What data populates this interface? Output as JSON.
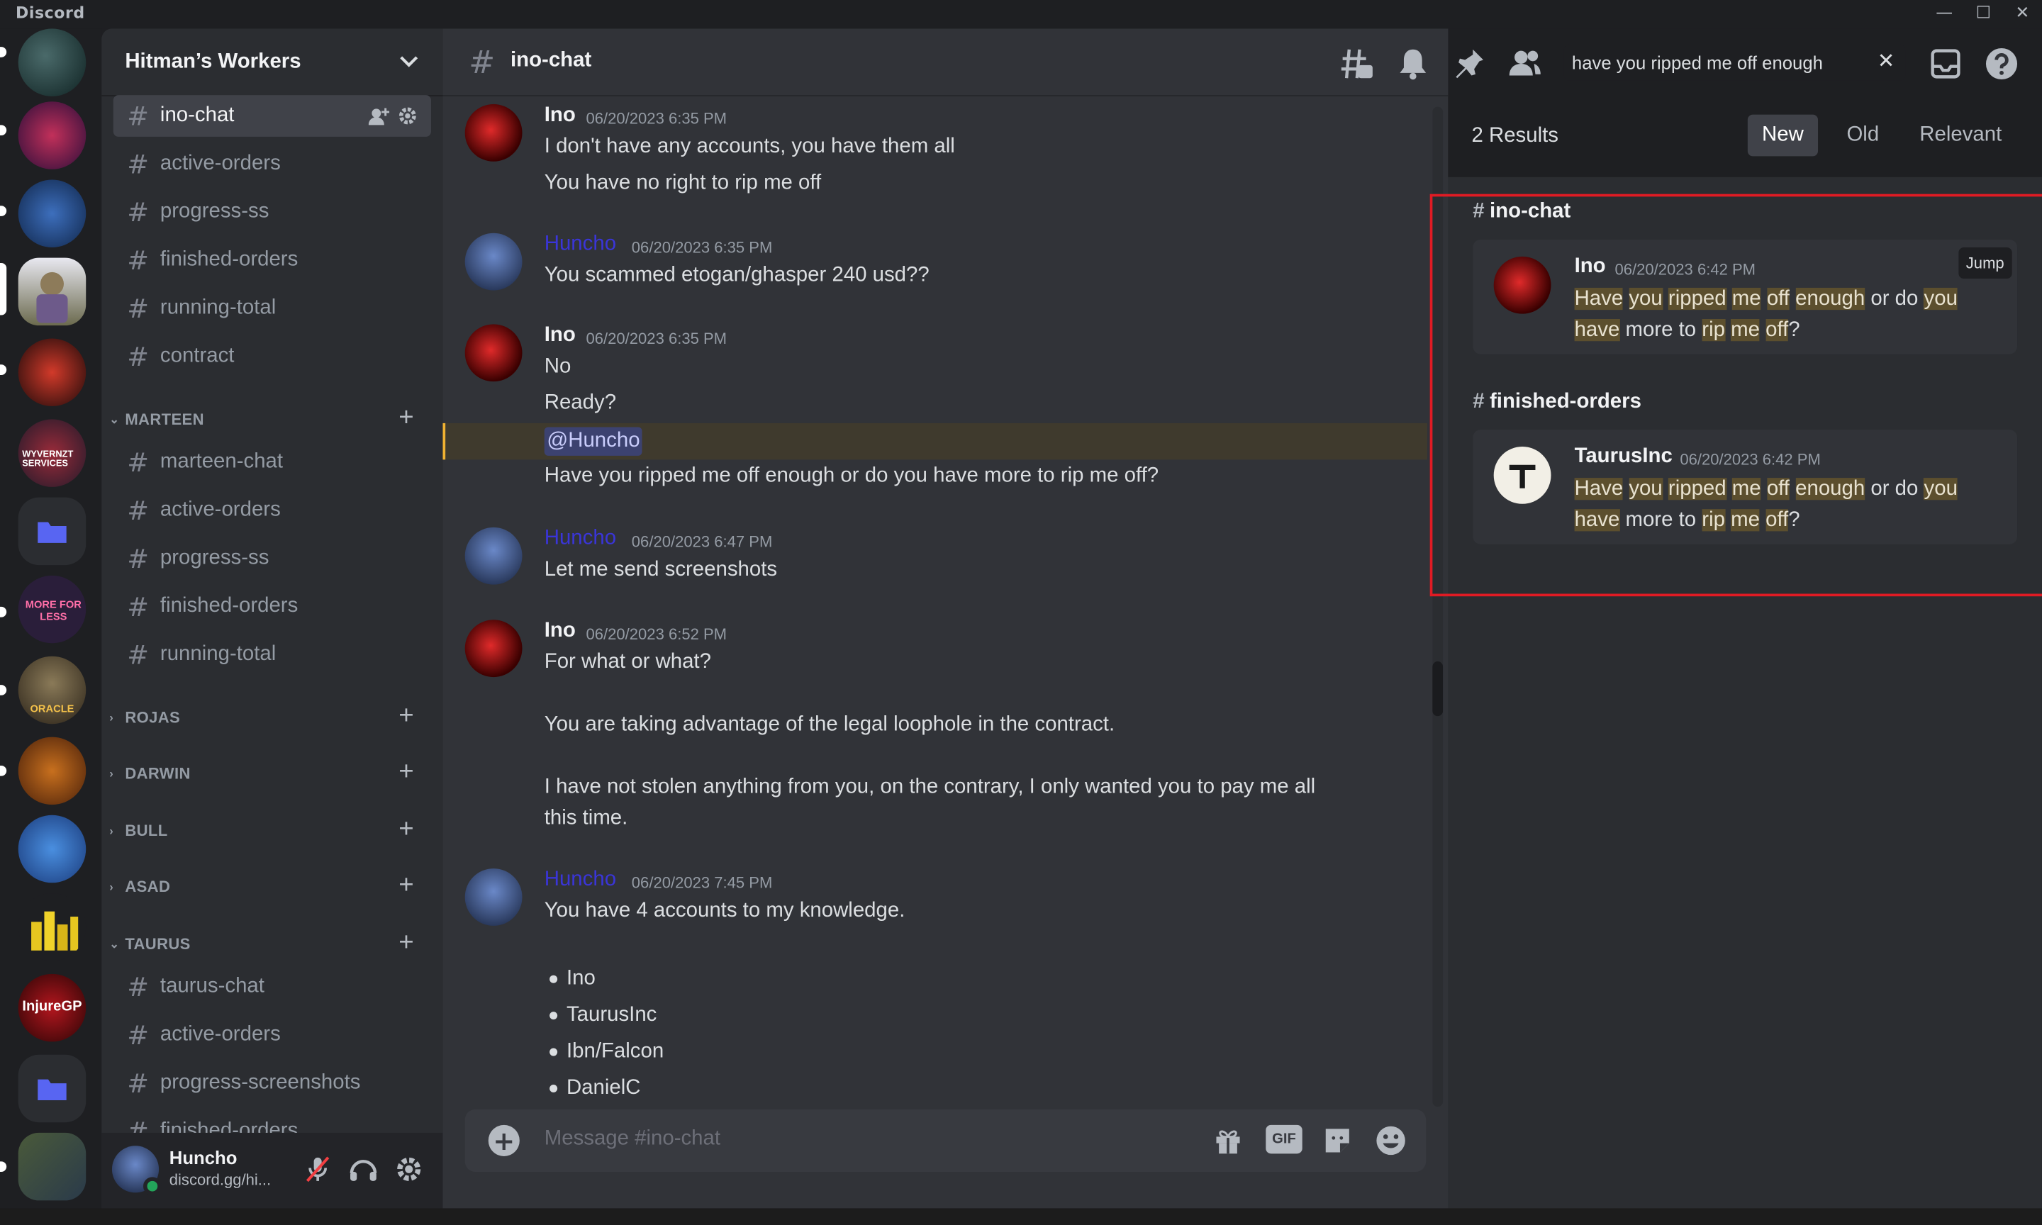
{
  "app": {
    "title": "Discord"
  },
  "window": {
    "minimize": "—",
    "maximize": "☐",
    "close": "✕"
  },
  "guild": {
    "name": "Hitman’s Workers"
  },
  "channels_top": [
    "ino-chat",
    "active-orders",
    "progress-ss",
    "finished-orders",
    "running-total",
    "contract"
  ],
  "categories": {
    "marteen": {
      "label": "MARTEEN",
      "channels": [
        "marteen-chat",
        "active-orders",
        "progress-ss",
        "finished-orders",
        "running-total"
      ]
    },
    "rojas": {
      "label": "ROJAS"
    },
    "darwin": {
      "label": "DARWIN"
    },
    "bull": {
      "label": "BULL"
    },
    "asad": {
      "label": "ASAD"
    },
    "taurus": {
      "label": "TAURUS",
      "channels": [
        "taurus-chat",
        "active-orders",
        "progress-screenshots",
        "finished-orders"
      ]
    }
  },
  "user": {
    "name": "Huncho",
    "status": "discord.gg/hi..."
  },
  "chat": {
    "channel": "ino-chat",
    "composer_placeholder": "Message #ino-chat",
    "gif_label": "GIF",
    "messages": [
      {
        "author": "Ino",
        "time": "06/20/2023 6:35 PM",
        "lines": [
          "I don't have any accounts, you have them all",
          "You have no right to rip me off"
        ]
      },
      {
        "author": "Huncho",
        "time": "06/20/2023 6:35 PM",
        "lines": [
          "You scammed etogan/ghasper 240 usd??"
        ]
      },
      {
        "author": "Ino",
        "time": "06/20/2023 6:35 PM",
        "lines": [
          "No",
          "Ready?"
        ],
        "mention": "@Huncho",
        "after_mention": "Have you ripped me off enough or do you have more to rip me off?"
      },
      {
        "author": "Huncho",
        "time": "06/20/2023 6:47 PM",
        "lines": [
          "Let me send screenshots"
        ]
      },
      {
        "author": "Ino",
        "time": "06/20/2023 6:52 PM",
        "lines": [
          "For what or what?",
          "You are taking advantage of the legal loophole in the contract.",
          "I have not stolen anything from you, on the contrary, I only wanted you to pay me all",
          "this time."
        ]
      },
      {
        "author": "Huncho",
        "time": "06/20/2023 7:45 PM",
        "lines": [
          "You have 4 accounts to my knowledge."
        ],
        "bullets": [
          "Ino",
          "TaurusInc",
          "Ibn/Falcon",
          "DanielC"
        ]
      }
    ]
  },
  "search": {
    "query": "have you ripped me off enough",
    "results_count": "2 Results",
    "sort_options": [
      "New",
      "Old",
      "Relevant"
    ],
    "sort_selected": "New",
    "results": [
      {
        "channel": "ino-chat",
        "author": "Ino",
        "time": "06/20/2023 6:42 PM",
        "jump": "Jump"
      },
      {
        "channel": "finished-orders",
        "author": "TaurusInc",
        "time": "06/20/2023 6:42 PM"
      }
    ],
    "result_text_words": [
      "Have",
      "you",
      "ripped",
      "me",
      "off",
      "enough",
      "or do",
      "you",
      "have",
      "more to",
      "rip",
      "me",
      "off",
      "?"
    ]
  },
  "servers": [
    {
      "label": "WYVERNZT SERVICES"
    },
    {
      "label": "MORE FOR LESS"
    },
    {
      "label": "ORACLE"
    },
    {
      "label": "InjureGP"
    }
  ],
  "colors": {
    "accent": "#5865f2",
    "online": "#23a55a",
    "highlight": "#5c4f2e",
    "mention_row": "#3f3a2d",
    "frame": "#e01b24"
  }
}
